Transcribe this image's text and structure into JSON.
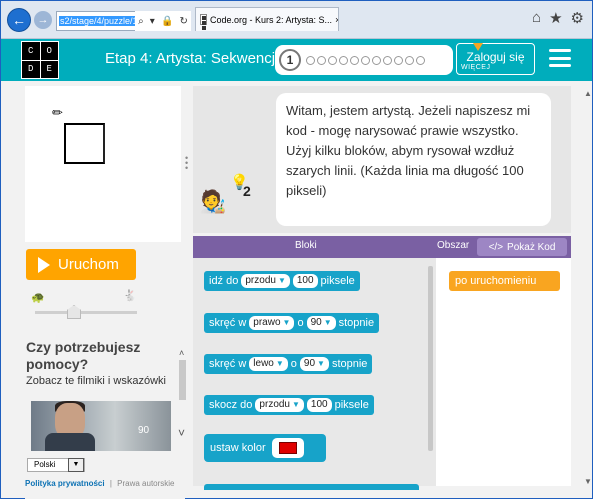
{
  "browser": {
    "address": "s2/stage/4/puzzle/1",
    "address_tail": "",
    "tab_title": "Code.org - Kurs 2: Artysta: S...",
    "back": "←",
    "forward": "→",
    "tab_close": "×"
  },
  "header": {
    "logo_letters": [
      "C",
      "O",
      "D",
      "E"
    ],
    "stage_title": "Etap 4: Artysta: Sekwencja",
    "current_puzzle": "1",
    "puzzle_dots": 11,
    "login_label": "Zaloguj się",
    "more_label": "WIĘCEJ"
  },
  "left": {
    "run_label": "Uruchom",
    "help_title": "Czy potrzebujesz pomocy?",
    "help_sub": "Zobacz te filmiki i wskazówki",
    "video_number": "90",
    "language": "Polski",
    "privacy_link": "Polityka prywatności",
    "separator": "|",
    "rights_link": "Prawa autorskie"
  },
  "instructions": {
    "text": "Witam, jestem artystą. Jeżeli napiszesz mi kod - mogę narysować prawie wszystko. Użyj kilku bloków, abym rysował wzdłuż szarych linii. (Każda linia ma długość 100 pikseli)",
    "hint_count": "2"
  },
  "workspace": {
    "toolbox_label": "Bloki",
    "workspace_label": "Obszar",
    "show_code_label": "Pokaż Kod",
    "blocks": [
      {
        "prefix": "idź do",
        "field1": "przodu",
        "mid": "",
        "value": "100",
        "suffix": "piksele"
      },
      {
        "prefix": "skręć w",
        "field1": "prawo",
        "mid": "o",
        "value": "90",
        "suffix": "stopnie"
      },
      {
        "prefix": "skręć w",
        "field1": "lewo",
        "mid": "o",
        "value": "90",
        "suffix": "stopnie"
      },
      {
        "prefix": "skocz do",
        "field1": "przodu",
        "mid": "",
        "value": "100",
        "suffix": "piksele"
      }
    ],
    "color_block_label": "ustaw kolor",
    "color_value": "#e00000",
    "on_run_label": "po uruchomieniu"
  },
  "colors": {
    "header": "#00adbc",
    "run_button": "#ffa400",
    "toolbar": "#7a60a3",
    "block": "#17a3c9",
    "event_block": "#f9a520"
  }
}
